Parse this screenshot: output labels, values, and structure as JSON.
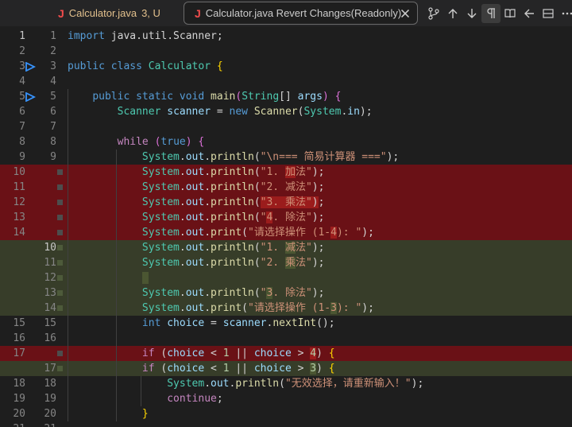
{
  "tabs": [
    {
      "name": "Calculator.java",
      "status": "3, U",
      "icon": "java-file-icon"
    },
    {
      "name": "Calculator.java Revert Changes(Readonly)",
      "icon": "java-file-icon"
    }
  ],
  "toolbar": [
    "source-control-icon",
    "arrow-up-icon",
    "arrow-down-icon",
    "pilcrow-icon",
    "book-icon",
    "arrow-left-icon",
    "layout-icon",
    "more-icon"
  ],
  "rows": [
    {
      "l": "1",
      "r": "1",
      "t": "",
      "h": "<span class='kw'>import</span> java.util.Scanner;"
    },
    {
      "l": "2",
      "r": "2",
      "t": "",
      "h": ""
    },
    {
      "l": "3",
      "r": "3",
      "t": "",
      "bp": true,
      "h": "<span class='kw'>public</span> <span class='kw'>class</span> <span class='ty'>Calculator</span> <span class='br'>{</span>"
    },
    {
      "l": "4",
      "r": "4",
      "t": "",
      "h": ""
    },
    {
      "l": "5",
      "r": "5",
      "t": "",
      "bp": true,
      "h": "    <span class='kw'>public</span> <span class='kw'>static</span> <span class='kw'>void</span> <span class='fn'>main</span><span class='bp2'>(</span><span class='ty'>String</span>[] <span class='va'>args</span><span class='bp2'>)</span> <span class='bp2'>{</span>"
    },
    {
      "l": "6",
      "r": "6",
      "t": "",
      "h": "        <span class='ty'>Scanner</span> <span class='va'>scanner</span> = <span class='kw'>new</span> <span class='fn'>Scanner</span>(<span class='ty'>System</span>.<span class='va'>in</span>);"
    },
    {
      "l": "7",
      "r": "7",
      "t": "",
      "h": ""
    },
    {
      "l": "8",
      "r": "8",
      "t": "",
      "h": "        <span class='kc'>while</span> <span class='bp2'>(</span><span class='kw'>true</span><span class='bp2'>)</span> <span class='bp2'>{</span>"
    },
    {
      "l": "9",
      "r": "9",
      "t": "",
      "h": "            <span class='ty'>System</span>.<span class='va'>out</span>.<span class='fn'>println</span>(<span class='st'>\"\\n=== 简易计算器 ===\"</span>);"
    },
    {
      "l": "10",
      "r": "",
      "t": "rm",
      "h": "            <span class='ty'>System</span>.<span class='va'>out</span>.<span class='fn'>println</span>(<span class='st'>\"1. <span class='hl-red'>加</span>法\"</span>);"
    },
    {
      "l": "11",
      "r": "",
      "t": "rm",
      "h": "            <span class='ty'>System</span>.<span class='va'>out</span>.<span class='fn'>println</span>(<span class='st'>\"2. 减法\"</span>);"
    },
    {
      "l": "12",
      "r": "",
      "t": "rm",
      "h": "            <span class='ty'>System</span>.<span class='va'>out</span>.<span class='fn'>println</span>(<span class='st'><span class='hl-red'>\"3. 乘法\"</span></span><span class='hl-red'>)</span>;"
    },
    {
      "l": "13",
      "r": "",
      "t": "rm",
      "h": "            <span class='ty'>System</span>.<span class='va'>out</span>.<span class='fn'>println</span>(<span class='st'>\"<span class='hl-red'>4</span>. 除法\"</span>);"
    },
    {
      "l": "14",
      "r": "",
      "t": "rm",
      "h": "            <span class='ty'>System</span>.<span class='va'>out</span>.<span class='fn'>print</span>(<span class='st'>\"请选择操作 (1-<span class='hl-red'>4</span>): \"</span>);"
    },
    {
      "l": "",
      "r": "10",
      "t": "ad",
      "cur": true,
      "h": "            <span class='ty'>System</span>.<span class='va'>out</span>.<span class='fn'>println</span>(<span class='st'>\"1. <span class='hl-grn'>减</span>法\"</span>);"
    },
    {
      "l": "",
      "r": "11",
      "t": "ad",
      "h": "            <span class='ty'>System</span>.<span class='va'>out</span>.<span class='fn'>println</span>(<span class='st'>\"2. <span class='hl-grn'>乘</span>法\"</span>);"
    },
    {
      "l": "",
      "r": "12",
      "t": "ad",
      "h": "            <span class='hl-grn'> </span>"
    },
    {
      "l": "",
      "r": "13",
      "t": "ad",
      "h": "            <span class='ty'>System</span>.<span class='va'>out</span>.<span class='fn'>println</span>(<span class='st'>\"<span class='hl-grn'>3</span>. 除法\"</span>);"
    },
    {
      "l": "",
      "r": "14",
      "t": "ad",
      "h": "            <span class='ty'>System</span>.<span class='va'>out</span>.<span class='fn'>print</span>(<span class='st'>\"请选择操作 (1-<span class='hl-grn'>3</span>): \"</span>);"
    },
    {
      "l": "15",
      "r": "15",
      "t": "",
      "h": "            <span class='kw'>int</span> <span class='va'>choice</span> = <span class='va'>scanner</span>.<span class='fn'>nextInt</span>();"
    },
    {
      "l": "16",
      "r": "16",
      "t": "",
      "h": ""
    },
    {
      "l": "17",
      "r": "",
      "t": "rm",
      "h": "            <span class='kc'>if</span> (<span class='va'>choice</span> &lt; <span class='nu'>1</span> || <span class='va'>choice</span> &gt; <span class='nu hl-red'>4</span>) <span class='br'>{</span>"
    },
    {
      "l": "",
      "r": "17",
      "t": "ad",
      "h": "            <span class='kc'>if</span> (<span class='va'>choice</span> &lt; <span class='nu'>1</span> || <span class='va'>choice</span> &gt; <span class='nu hl-grn'>3</span>) <span class='br'>{</span>"
    },
    {
      "l": "18",
      "r": "18",
      "t": "",
      "h": "                <span class='ty'>System</span>.<span class='va'>out</span>.<span class='fn'>println</span>(<span class='st'>\"无效选择，请重新输入！\"</span>);"
    },
    {
      "l": "19",
      "r": "19",
      "t": "",
      "h": "                <span class='kc'>continue</span>;"
    },
    {
      "l": "20",
      "r": "20",
      "t": "",
      "h": "            <span class='br'>}</span>"
    },
    {
      "l": "21",
      "r": "21",
      "t": "",
      "h": ""
    }
  ]
}
